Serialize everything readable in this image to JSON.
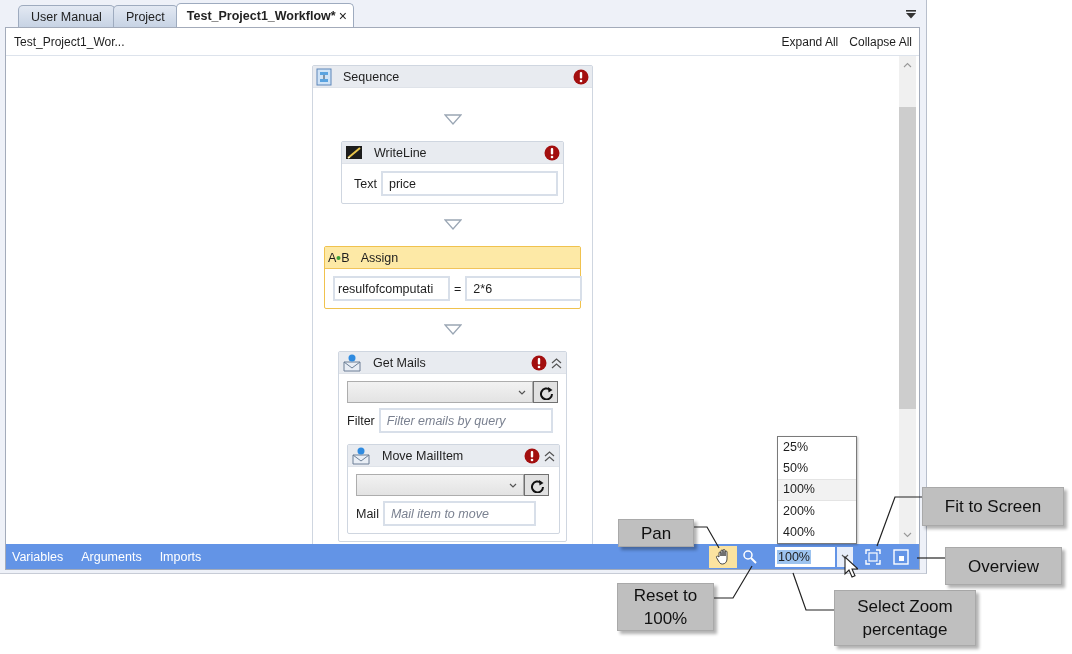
{
  "tabs": [
    {
      "label": "User Manual",
      "selected": false,
      "closable": false
    },
    {
      "label": "Project",
      "selected": false,
      "closable": false
    },
    {
      "label": "Test_Project1_Workflow*",
      "selected": true,
      "closable": true
    }
  ],
  "tab_close": "×",
  "breadcrumb": "Test_Project1_Wor...",
  "header_links": [
    "Expand All",
    "Collapse All"
  ],
  "sequence": {
    "title": "Sequence",
    "error": true,
    "activities": [
      {
        "kind": "writeline",
        "title": "WriteLine",
        "error": true,
        "label": "Text",
        "value": "price"
      },
      {
        "kind": "assign",
        "title": "Assign",
        "selected": true,
        "icon_letters": [
          "A",
          "B"
        ],
        "to": "resulfofcomputati",
        "operator": "=",
        "value": "2*6"
      },
      {
        "kind": "getmails",
        "title": "Get Mails",
        "error": true,
        "expanded": true,
        "filter_label": "Filter",
        "filter_placeholder": "Filter emails by query",
        "children": [
          {
            "kind": "movemail",
            "title": "Move MailItem",
            "error": true,
            "expanded": true,
            "label": "Mail",
            "placeholder": "Mail item to move"
          }
        ]
      }
    ]
  },
  "bottom_tabs": [
    "Variables",
    "Arguments",
    "Imports"
  ],
  "tools": {
    "pan_active": true
  },
  "zoom": {
    "value": "100%",
    "expanded": true,
    "options": [
      {
        "label": "25%",
        "selected": false
      },
      {
        "label": "50%",
        "selected": false
      },
      {
        "label": "100%",
        "selected": true
      },
      {
        "label": "200%",
        "selected": false
      },
      {
        "label": "400%",
        "selected": false
      }
    ]
  },
  "callouts": [
    {
      "kind": "pan",
      "text": "Pan"
    },
    {
      "kind": "reset",
      "text": "Reset to 100%"
    },
    {
      "kind": "zoom",
      "text": "Select Zoom percentage"
    },
    {
      "kind": "fit",
      "text": "Fit to Screen"
    },
    {
      "kind": "overview",
      "text": "Overview"
    }
  ]
}
